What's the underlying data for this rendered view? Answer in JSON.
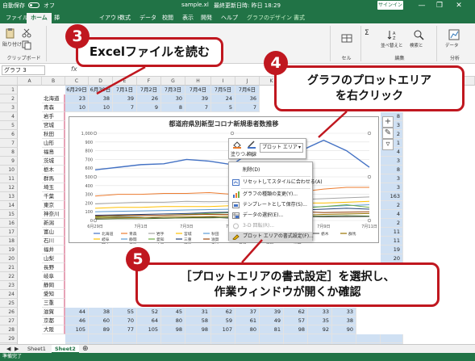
{
  "titlebar": {
    "autosave": "自動保存",
    "autosave_state": "オフ",
    "file_name": "sample.xl",
    "last_update": "最終更新日時: 昨日 18:29",
    "signin": "サインイン"
  },
  "tabs": [
    {
      "label": "ファイル",
      "active": false
    },
    {
      "label": "ホーム",
      "active": true
    },
    {
      "label": "挿",
      "active": false
    },
    {
      "label": "イアウト",
      "active": false
    },
    {
      "label": "数式",
      "active": false
    },
    {
      "label": "データ",
      "active": false
    },
    {
      "label": "校閲",
      "active": false
    },
    {
      "label": "表示",
      "active": false
    },
    {
      "label": "開発",
      "active": false
    },
    {
      "label": "ヘルプ",
      "active": false
    },
    {
      "label": "グラフのデザイン",
      "active": false
    },
    {
      "label": "書式",
      "active": false
    }
  ],
  "ribbon": {
    "clipboard": "クリップボード",
    "paste": "貼り付け",
    "cell": "セル",
    "edit": "編集",
    "analysis": "分析",
    "sum": "Σ",
    "sort_filter": "並べ替えと\nフィルター",
    "find_select": "検索と\n選択",
    "data_analysis": "データ\n分析"
  },
  "formula_bar": {
    "name_box": "グラフ 3",
    "fx": "fx"
  },
  "columns": [
    "A",
    "B",
    "C",
    "D",
    "E",
    "F",
    "G",
    "H",
    "I",
    "J",
    "K",
    "L",
    "M",
    "N",
    "O",
    "P",
    "Q",
    "R"
  ],
  "row_numbers": [
    "1",
    "2",
    "3",
    "4",
    "5",
    "6",
    "7",
    "8",
    "9",
    "10",
    "11",
    "12",
    "13",
    "14",
    "15",
    "16",
    "17",
    "18",
    "19",
    "20",
    "21",
    "22",
    "23",
    "24",
    "25",
    "26",
    "27",
    "28",
    "29",
    "30"
  ],
  "dates": [
    "6月29日",
    "6月30日",
    "7月1日",
    "7月2日",
    "7月3日",
    "7月4日",
    "7月5日",
    "7月6日"
  ],
  "prefectures": [
    "北海道",
    "青森",
    "岩手",
    "宮城",
    "秋田",
    "山形",
    "福島",
    "茨城",
    "栃木",
    "群馬",
    "埼玉",
    "千葉",
    "東京",
    "神奈川",
    "新潟",
    "富山",
    "石川",
    "福井",
    "山梨",
    "長野",
    "岐阜",
    "静岡",
    "愛知",
    "三重",
    "滋賀",
    "京都",
    "大阪"
  ],
  "row2": [
    "23",
    "38",
    "39",
    "26",
    "30",
    "39",
    "24",
    "36"
  ],
  "row3": [
    "10",
    "10",
    "7",
    "9",
    "8",
    "7",
    "5",
    "7"
  ],
  "row26": [
    "44",
    "38",
    "55",
    "52",
    "45",
    "31",
    "62",
    "37",
    "39",
    "62",
    "33",
    "33"
  ],
  "row27": [
    "46",
    "60",
    "70",
    "64",
    "80",
    "58",
    "59",
    "61",
    "49",
    "57",
    "35",
    "38"
  ],
  "row28": [
    "105",
    "89",
    "77",
    "105",
    "98",
    "98",
    "107",
    "80",
    "81",
    "98",
    "92",
    "90"
  ],
  "right_values": [
    "8",
    "3",
    "2",
    "1",
    "4",
    "3",
    "8",
    "3",
    "3",
    "163",
    "2",
    "4",
    "2",
    "11",
    "11",
    "19",
    "20"
  ],
  "chart": {
    "title": "都道府県別新型コロナ新規患者数推移",
    "y_ticks": [
      "1,000",
      "900",
      "800",
      "700",
      "600",
      "500",
      "400",
      "300",
      "200",
      "100",
      "0"
    ],
    "x_ticks": [
      "6月29日",
      "7月1日",
      "7月3日",
      "7月5日",
      "7月7日",
      "7月9日",
      "7月11日"
    ],
    "legend_rows": [
      [
        "北海道",
        "青森",
        "岩手",
        "宮城",
        "秋田",
        "山形",
        "福島",
        "茨城",
        "栃木",
        "群馬"
      ],
      [
        "岐阜",
        "静岡",
        "愛知",
        "三重",
        "滋賀",
        "京都",
        "大阪",
        "兵庫"
      ],
      [
        "岡山",
        "広島",
        "山口",
        "徳島",
        "香川",
        "愛媛",
        "高知",
        "福岡"
      ],
      [
        "長崎",
        "熊本"
      ]
    ]
  },
  "chart_data": {
    "type": "line",
    "title": "都道府県別新型コロナ新規患者数推移",
    "ylim": [
      0,
      1000
    ],
    "x": [
      "6月29日",
      "6月30日",
      "7月1日",
      "7月2日",
      "7月3日",
      "7月4日",
      "7月5日",
      "7月6日",
      "7月7日",
      "7月8日",
      "7月9日",
      "7月10日",
      "7月11日"
    ],
    "series": [
      {
        "name": "東京",
        "color": "#4472c4",
        "values": [
          580,
          610,
          640,
          650,
          700,
          680,
          640,
          820,
          850,
          800,
          920,
          800,
          610
        ]
      },
      {
        "name": "大阪",
        "color": "#ed7d31",
        "values": [
          280,
          300,
          300,
          310,
          310,
          320,
          300,
          330,
          340,
          330,
          360,
          380,
          380
        ]
      },
      {
        "name": "神奈川",
        "color": "#a5a5a5",
        "values": [
          190,
          200,
          210,
          210,
          220,
          215,
          220,
          230,
          240,
          240,
          250,
          260,
          270
        ]
      },
      {
        "name": "埼玉",
        "color": "#ffc000",
        "values": [
          140,
          150,
          150,
          160,
          160,
          160,
          170,
          180,
          190,
          200,
          200,
          210,
          220
        ]
      },
      {
        "name": "千葉",
        "color": "#5b9bd5",
        "values": [
          100,
          105,
          110,
          115,
          120,
          125,
          130,
          150,
          160,
          150,
          160,
          170,
          180
        ]
      },
      {
        "name": "愛知",
        "color": "#70ad47",
        "values": [
          40,
          50,
          60,
          60,
          70,
          80,
          90,
          110,
          120,
          140,
          160,
          180,
          150
        ]
      },
      {
        "name": "兵庫",
        "color": "#264478",
        "values": [
          60,
          65,
          70,
          75,
          80,
          90,
          95,
          100,
          110,
          120,
          130,
          140,
          130
        ]
      },
      {
        "name": "福岡",
        "color": "#9e480e",
        "values": [
          50,
          55,
          60,
          60,
          65,
          70,
          70,
          80,
          90,
          100,
          90,
          95,
          100
        ]
      },
      {
        "name": "北海道",
        "color": "#636363",
        "values": [
          23,
          38,
          39,
          26,
          30,
          39,
          24,
          36,
          40,
          45,
          40,
          42,
          45
        ]
      },
      {
        "name": "京都",
        "color": "#997300",
        "values": [
          30,
          30,
          35,
          40,
          40,
          45,
          50,
          55,
          60,
          60,
          70,
          75,
          80
        ]
      },
      {
        "name": "静岡",
        "color": "#43682b",
        "values": [
          15,
          20,
          20,
          25,
          30,
          30,
          35,
          40,
          40,
          45,
          50,
          55,
          50
        ]
      }
    ]
  },
  "mini_toolbar": {
    "fill": "塗りつぶし",
    "outline": "枠線",
    "dropdown": "プロット エリア"
  },
  "context_menu": [
    {
      "label": "削除(D)",
      "disabled": false,
      "icon": "delete-icon"
    },
    {
      "label": "リセットしてスタイルに合わせる(A)",
      "disabled": false,
      "icon": "reset-icon"
    },
    {
      "label": "グラフの種類の変更(Y)...",
      "disabled": false,
      "icon": "chart-type-icon"
    },
    {
      "label": "テンプレートとして保存(S)...",
      "disabled": false,
      "icon": "template-icon"
    },
    {
      "label": "データの選択(E)...",
      "disabled": false,
      "icon": "data-select-icon"
    },
    {
      "label": "3-D 回転(R)...",
      "disabled": true,
      "icon": "rotate-icon"
    },
    {
      "label": "プロット エリアの書式設定(F)...",
      "disabled": false,
      "icon": "format-icon"
    }
  ],
  "callouts": {
    "c3_num": "3",
    "c3_text": "Excelファイルを読む",
    "c4_num": "4",
    "c4_line1": "グラフのプロットエリア",
    "c4_line2": "を右クリック",
    "c5_num": "5",
    "c5_line1": "［プロットエリアの書式設定］を選択し、",
    "c5_line2": "作業ウィンドウが開くか確認"
  },
  "sheets": [
    {
      "label": "Sheet1",
      "active": false
    },
    {
      "label": "Sheet2",
      "active": true
    }
  ],
  "status": "準備完了",
  "colors": {
    "excel_green": "#217346",
    "callout_red": "#c0171f"
  }
}
